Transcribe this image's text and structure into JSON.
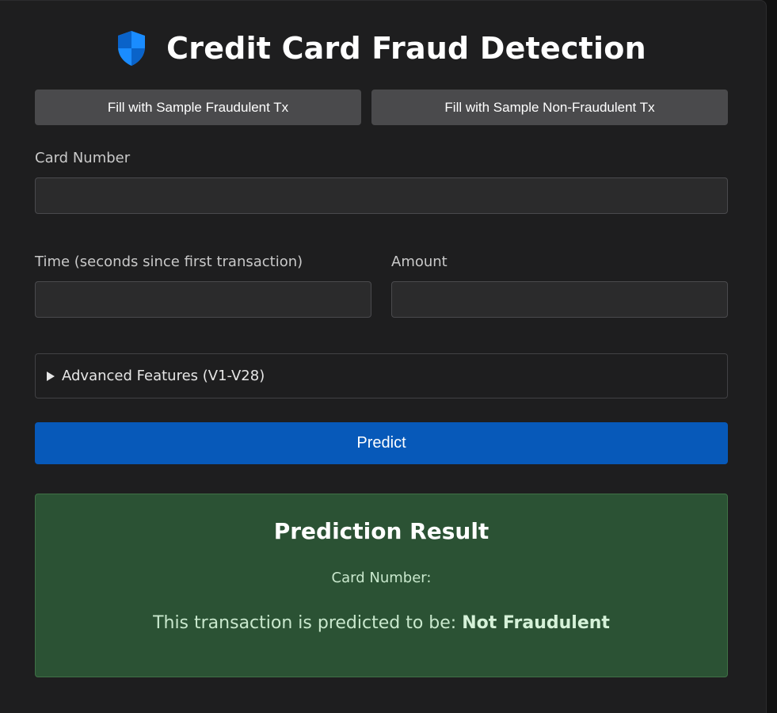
{
  "header": {
    "title": "Credit Card Fraud Detection",
    "icon": "shield-icon",
    "icon_color": "#1a8cff"
  },
  "samples": {
    "fraud_label": "Fill with Sample Fraudulent Tx",
    "nonfraud_label": "Fill with Sample Non-Fraudulent Tx"
  },
  "form": {
    "card_number_label": "Card Number",
    "card_number_value": "",
    "time_label": "Time (seconds since first transaction)",
    "time_value": "",
    "amount_label": "Amount",
    "amount_value": "",
    "advanced_label": "Advanced Features (V1-V28)",
    "predict_label": "Predict"
  },
  "result": {
    "title": "Prediction Result",
    "card_number_label": "Card Number:",
    "prediction_prefix": "This transaction is predicted to be: ",
    "prediction_value": "Not Fraudulent"
  },
  "colors": {
    "accent": "#0759b9",
    "result_bg": "#2b5234"
  }
}
